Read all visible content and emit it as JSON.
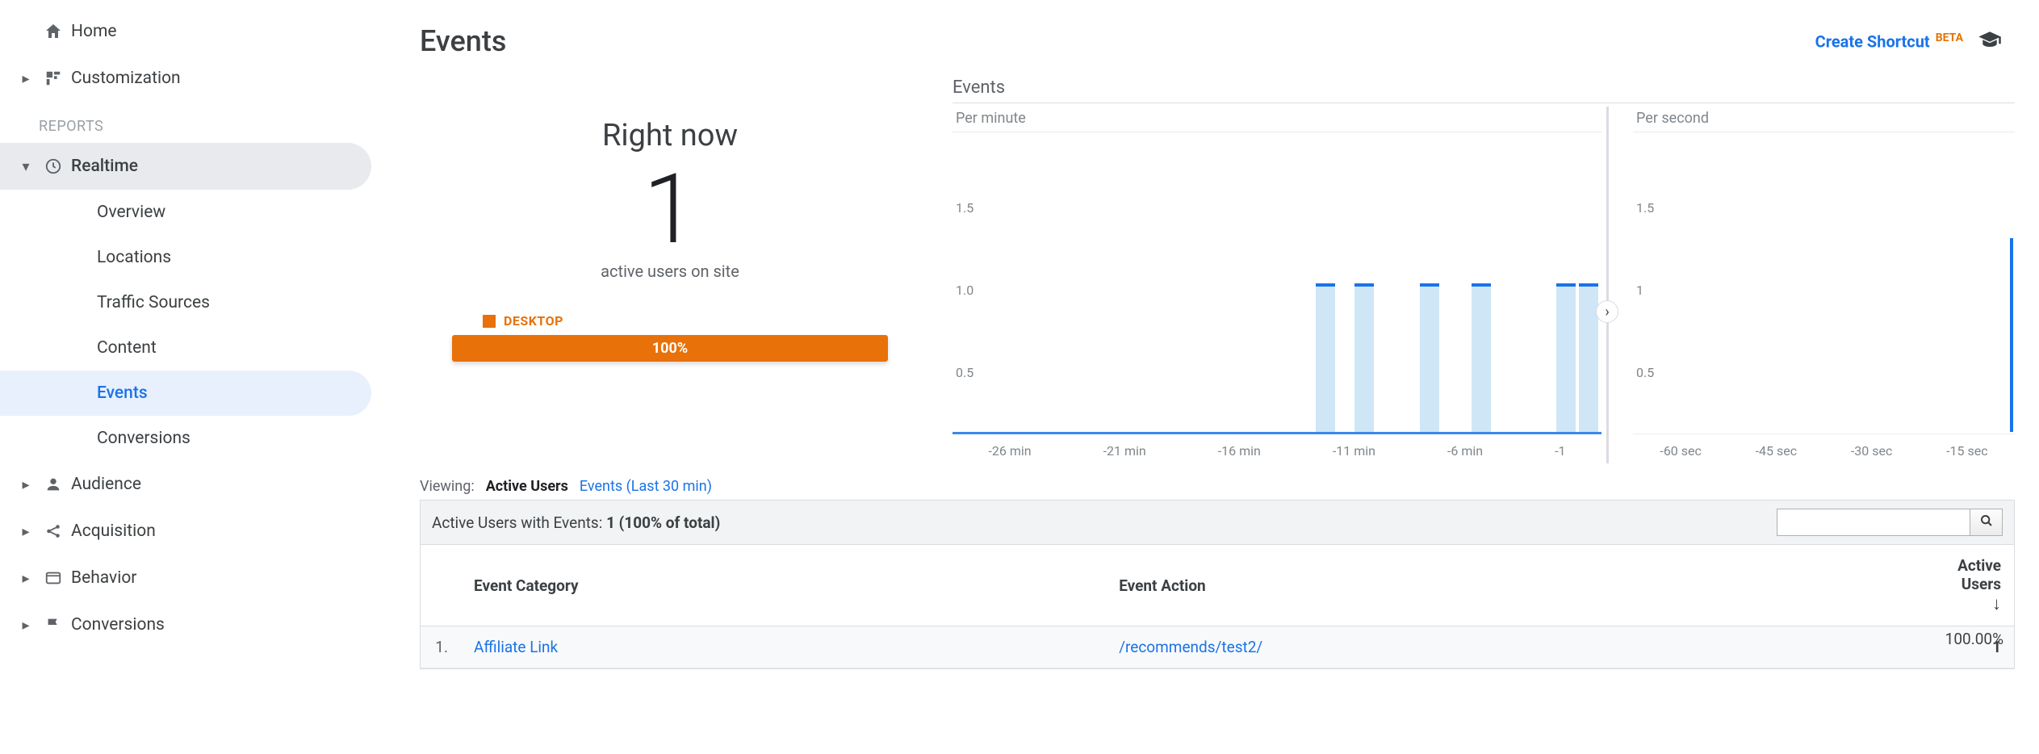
{
  "sidebar": {
    "home": "Home",
    "customization": "Customization",
    "reports_label": "REPORTS",
    "realtime": {
      "label": "Realtime",
      "items": [
        {
          "label": "Overview"
        },
        {
          "label": "Locations"
        },
        {
          "label": "Traffic Sources"
        },
        {
          "label": "Content"
        },
        {
          "label": "Events"
        },
        {
          "label": "Conversions"
        }
      ]
    },
    "audience": "Audience",
    "acquisition": "Acquisition",
    "behavior": "Behavior",
    "conversions": "Conversions"
  },
  "header": {
    "title": "Events",
    "create_shortcut": "Create Shortcut",
    "beta": "BETA"
  },
  "right_now": {
    "title": "Right now",
    "value": "1",
    "subtitle": "active users on site",
    "device_label": "DESKTOP",
    "device_pct": "100%"
  },
  "charts": {
    "title": "Events",
    "minute_label": "Per minute",
    "second_label": "Per second"
  },
  "chart_data": [
    {
      "type": "bar",
      "title": "Per minute",
      "xlabel": "",
      "ylabel": "",
      "ylim": [
        0,
        2
      ],
      "yticks": [
        0.5,
        1.0,
        1.5
      ],
      "categories": [
        "-26 min",
        "-21 min",
        "-16 min",
        "-11 min",
        "-6 min",
        "-1"
      ],
      "values_by_minute": {
        "-11": 1,
        "-10": 1,
        "-8": 1,
        "-6": 1,
        "-2": 1,
        "-1": 1
      }
    },
    {
      "type": "bar",
      "title": "Per second",
      "xlabel": "",
      "ylabel": "",
      "ylim": [
        0,
        2
      ],
      "yticks": [
        0.5,
        1.0,
        1.5
      ],
      "categories": [
        "-60 sec",
        "-45 sec",
        "-30 sec",
        "-15 sec"
      ],
      "values_by_second": {
        "0": 1
      }
    }
  ],
  "viewing": {
    "label": "Viewing:",
    "active_tab": "Active Users",
    "other_tab": "Events (Last 30 min)"
  },
  "table": {
    "caption_prefix": "Active Users with Events:",
    "caption_value": "1 (100% of total)",
    "columns": {
      "category": "Event Category",
      "action": "Event Action",
      "active": "Active Users"
    },
    "rows": [
      {
        "idx": "1.",
        "category": "Affiliate Link",
        "action": "/recommends/test2/",
        "active": "1",
        "pct": "100.00%"
      }
    ]
  }
}
